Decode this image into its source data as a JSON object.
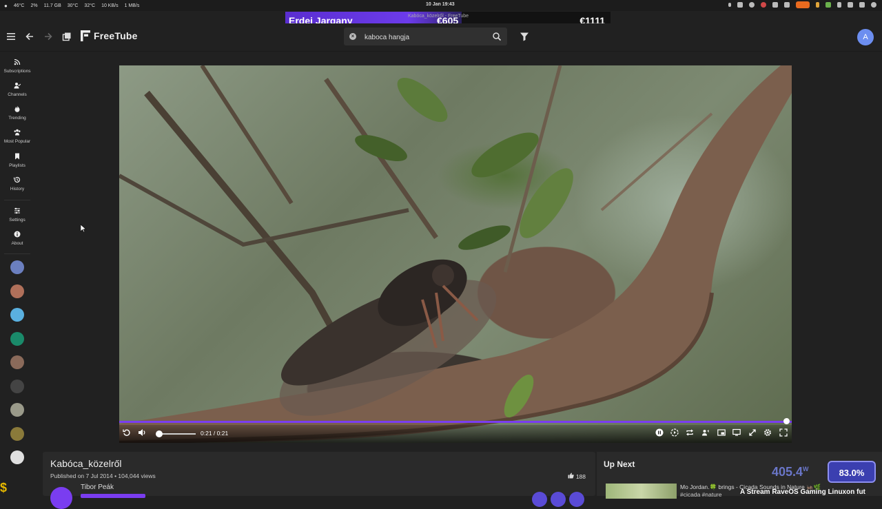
{
  "system_bar": {
    "stats": [
      "46°C",
      "2%",
      "11.7 GB",
      "30°C",
      "32°C",
      "10 KB/s",
      "1 MB/s"
    ],
    "clock": "10 Jan  19:43"
  },
  "stream_overlay": {
    "donor_name": "Erdei Jargany",
    "donation_amount": "€605",
    "total_amount": "€1111",
    "window_title": "Kabóca_közelről - FreeTube",
    "power": "405.4",
    "power_unit": "W",
    "percentage": "83.0%",
    "ticker": "A Stream RaveOS Gaming Linuxon fut"
  },
  "app": {
    "name": "FreeTube",
    "search_value": "kaboca hangja",
    "avatar_letter": "A"
  },
  "sidebar": {
    "items": [
      {
        "label": "Subscriptions",
        "icon": "rss-icon"
      },
      {
        "label": "Channels",
        "icon": "user-check-icon"
      },
      {
        "label": "Trending",
        "icon": "fire-icon"
      },
      {
        "label": "Most Popular",
        "icon": "users-icon"
      },
      {
        "label": "Playlists",
        "icon": "bookmark-icon"
      },
      {
        "label": "History",
        "icon": "history-icon"
      },
      {
        "label": "Settings",
        "icon": "sliders-icon"
      },
      {
        "label": "About",
        "icon": "info-icon"
      }
    ],
    "channel_colors": [
      "#6b7fbf",
      "#b0705a",
      "#5ab0e0",
      "#1a8a6a",
      "#8a6a5a",
      "#444444",
      "#9a9a8a",
      "#8a7a3a",
      "#e0e0e0"
    ]
  },
  "player": {
    "time": "0:21 / 0:21",
    "progress": 1.0,
    "volume": 0.0,
    "accent": "#7a3df0"
  },
  "video": {
    "title": "Kabóca_közelről",
    "published": "Published on 7 Jul 2014 • 104,044 views",
    "likes": "188",
    "channel": "Tibor Peák"
  },
  "up_next": {
    "heading": "Up Next",
    "item_title": "Mo Jordan.🍀 brings - Cicada Sounds in Nature 🦗🌿",
    "item_tags": "#cicada #nature"
  }
}
